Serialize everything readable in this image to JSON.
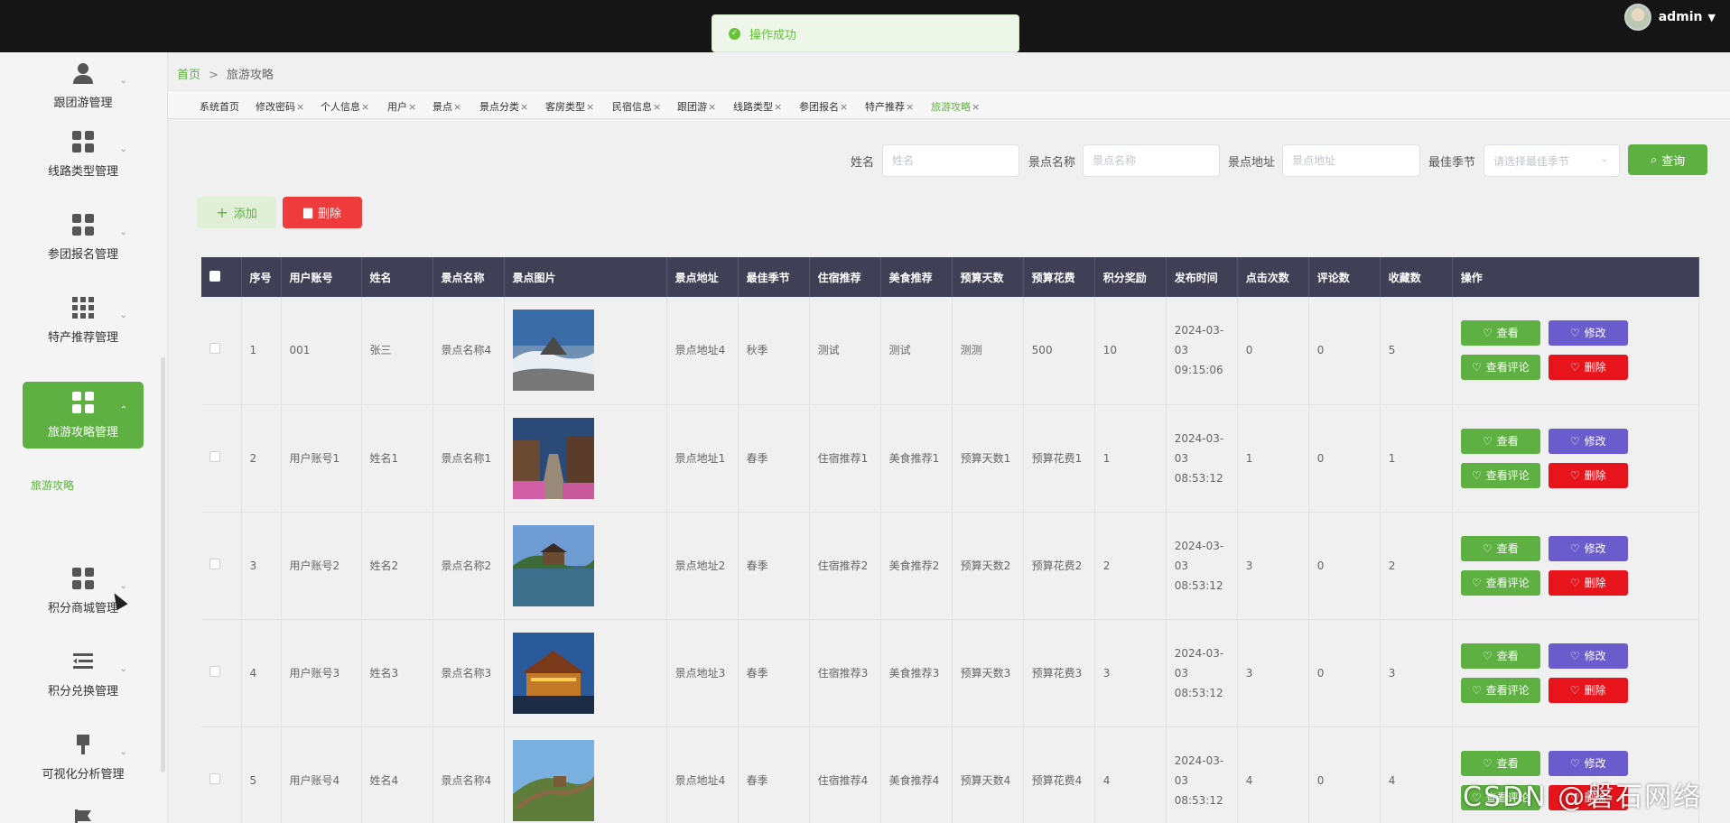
{
  "header": {
    "username": "admin"
  },
  "toast": {
    "message": "操作成功"
  },
  "sidebar": {
    "items": [
      {
        "label": "跟团游管理",
        "icon": "user-icon"
      },
      {
        "label": "线路类型管理",
        "icon": "grid-icon"
      },
      {
        "label": "参团报名管理",
        "icon": "grid-icon"
      },
      {
        "label": "特产推荐管理",
        "icon": "table-grid-icon"
      },
      {
        "label": "旅游攻略管理",
        "icon": "grid-icon",
        "active": true
      },
      {
        "label": "积分商城管理",
        "icon": "grid-icon"
      },
      {
        "label": "积分兑换管理",
        "icon": "list-icon"
      },
      {
        "label": "可视化分析管理",
        "icon": "brush-icon"
      },
      {
        "label": "",
        "icon": "flag-icon"
      }
    ],
    "submenu_label": "旅游攻略"
  },
  "breadcrumb": {
    "home": "首页",
    "current": "旅游攻略"
  },
  "tabs": [
    "系统首页",
    "修改密码",
    "个人信息",
    "用户",
    "景点",
    "景点分类",
    "客房类型",
    "民宿信息",
    "跟团游",
    "线路类型",
    "参团报名",
    "特产推荐",
    "旅游攻略"
  ],
  "search": {
    "name_label": "姓名",
    "name_placeholder": "姓名",
    "spot_label": "景点名称",
    "spot_placeholder": "景点名称",
    "addr_label": "景点地址",
    "addr_placeholder": "景点地址",
    "season_label": "最佳季节",
    "season_placeholder": "请选择最佳季节",
    "query_label": "查询"
  },
  "actions": {
    "add_label": "添加",
    "delete_label": "删除"
  },
  "table": {
    "headers": [
      "序号",
      "用户账号",
      "姓名",
      "景点名称",
      "景点图片",
      "景点地址",
      "最佳季节",
      "住宿推荐",
      "美食推荐",
      "预算天数",
      "预算花费",
      "积分奖励",
      "发布时间",
      "点击次数",
      "评论数",
      "收藏数",
      "操作"
    ],
    "op_labels": {
      "view": "查看",
      "edit": "修改",
      "comment": "查看评论",
      "remove": "删除"
    },
    "rows": [
      {
        "no": "1",
        "account": "001",
        "name": "张三",
        "spot": "景点名称4",
        "addr": "景点地址4",
        "season": "秋季",
        "stay": "测试",
        "food": "测试",
        "days": "测测",
        "cost": "500",
        "points": "10",
        "time": "2024-03-03 09:15:06",
        "clicks": "0",
        "comments": "0",
        "favs": "5",
        "image": "mountain-cloud-sea"
      },
      {
        "no": "2",
        "account": "用户账号1",
        "name": "姓名1",
        "spot": "景点名称1",
        "addr": "景点地址1",
        "season": "春季",
        "stay": "住宿推荐1",
        "food": "美食推荐1",
        "days": "预算天数1",
        "cost": "预算花费1",
        "points": "1",
        "time": "2024-03-03 08:53:12",
        "clicks": "1",
        "comments": "0",
        "favs": "1",
        "image": "old-town-street"
      },
      {
        "no": "3",
        "account": "用户账号2",
        "name": "姓名2",
        "spot": "景点名称2",
        "addr": "景点地址2",
        "season": "春季",
        "stay": "住宿推荐2",
        "food": "美食推荐2",
        "days": "预算天数2",
        "cost": "预算花费2",
        "points": "2",
        "time": "2024-03-03 08:53:12",
        "clicks": "3",
        "comments": "0",
        "favs": "2",
        "image": "lake-pavilion"
      },
      {
        "no": "4",
        "account": "用户账号3",
        "name": "姓名3",
        "spot": "景点名称3",
        "addr": "景点地址3",
        "season": "春季",
        "stay": "住宿推荐3",
        "food": "美食推荐3",
        "days": "预算天数3",
        "cost": "预算花费3",
        "points": "3",
        "time": "2024-03-03 08:53:12",
        "clicks": "3",
        "comments": "0",
        "favs": "3",
        "image": "night-temple"
      },
      {
        "no": "5",
        "account": "用户账号4",
        "name": "姓名4",
        "spot": "景点名称4",
        "addr": "景点地址4",
        "season": "春季",
        "stay": "住宿推荐4",
        "food": "美食推荐4",
        "days": "预算天数4",
        "cost": "预算花费4",
        "points": "4",
        "time": "2024-03-03 08:53:12",
        "clicks": "4",
        "comments": "0",
        "favs": "4",
        "image": "great-wall"
      }
    ]
  },
  "watermark": "CSDN @磐石网络",
  "colors": {
    "accent": "#5fb043",
    "danger": "#e8141c",
    "edit": "#6a5ccc",
    "header": "#3f3f56",
    "topbar": "#151515"
  }
}
